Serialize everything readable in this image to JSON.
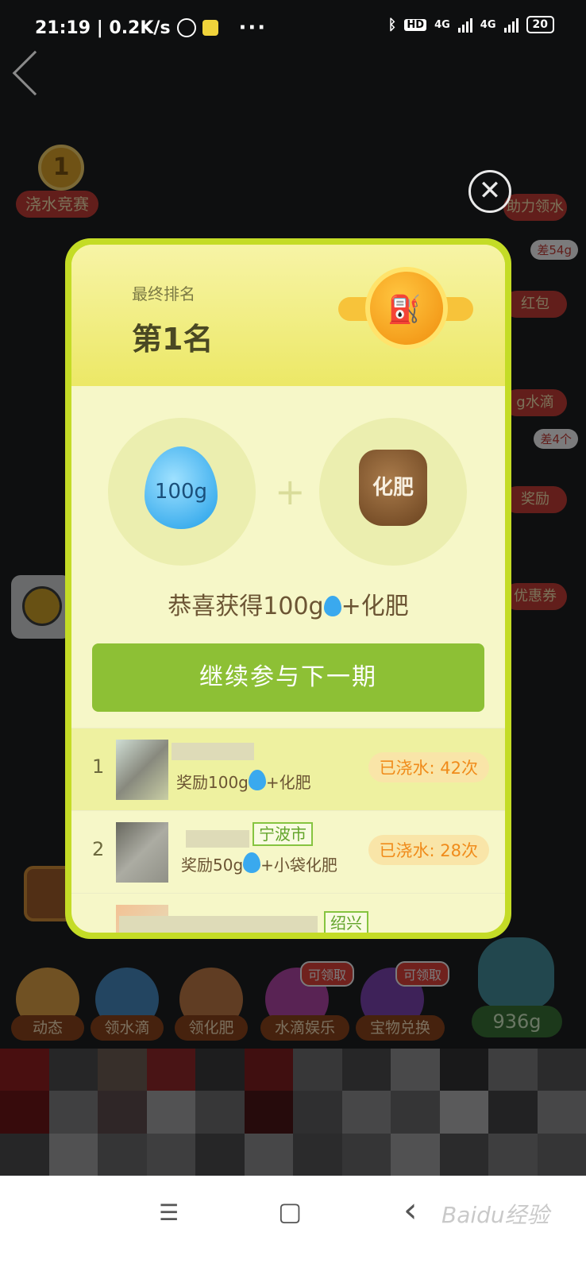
{
  "status_bar": {
    "time_speed": "21:19 | 0.2K/s",
    "dots": "···",
    "hd": "HD",
    "net1": "4G",
    "net2": "4G",
    "battery": "20"
  },
  "background": {
    "contest": {
      "rank": "1",
      "label": "浇水竞赛"
    },
    "right": {
      "help_water": "助力领水",
      "diff_54": "差54g",
      "red_packet": "红包",
      "water_drops": "g水滴",
      "diff_4": "差4个",
      "reward": "奖励",
      "coupon": "优惠券"
    },
    "tools": [
      {
        "label": "动态",
        "claim": ""
      },
      {
        "label": "领水滴",
        "claim": ""
      },
      {
        "label": "领化肥",
        "claim": ""
      },
      {
        "label": "水滴娱乐",
        "claim": "可领取"
      },
      {
        "label": "宝物兑换",
        "claim": "可领取"
      }
    ],
    "pot_amount": "936g"
  },
  "modal": {
    "rank_caption": "最终排名",
    "rank_value": "第1名",
    "drop_amount": "100g",
    "bag_label": "化肥",
    "plus": "+",
    "congrats_prefix": "恭喜获得100g",
    "congrats_suffix": "+化肥",
    "continue_label": "继续参与下一期",
    "close_symbol": "✕",
    "leaderboard": [
      {
        "rank": "1",
        "city": "",
        "reward_prefix": "奖励100g",
        "reward_suffix": "+化肥",
        "watered": "已浇水: 42次"
      },
      {
        "rank": "2",
        "city": "宁波市",
        "reward_prefix": "奖励50g",
        "reward_suffix": "+小袋化肥",
        "watered": "已浇水: 28次"
      },
      {
        "rank": "",
        "city": "绍兴",
        "reward_prefix": "",
        "reward_suffix": "",
        "watered": ""
      }
    ]
  },
  "nav_bar": {
    "menu_icon": "☰",
    "home_icon": "▢",
    "back_icon": "‹",
    "watermark": "Baidu经验"
  }
}
